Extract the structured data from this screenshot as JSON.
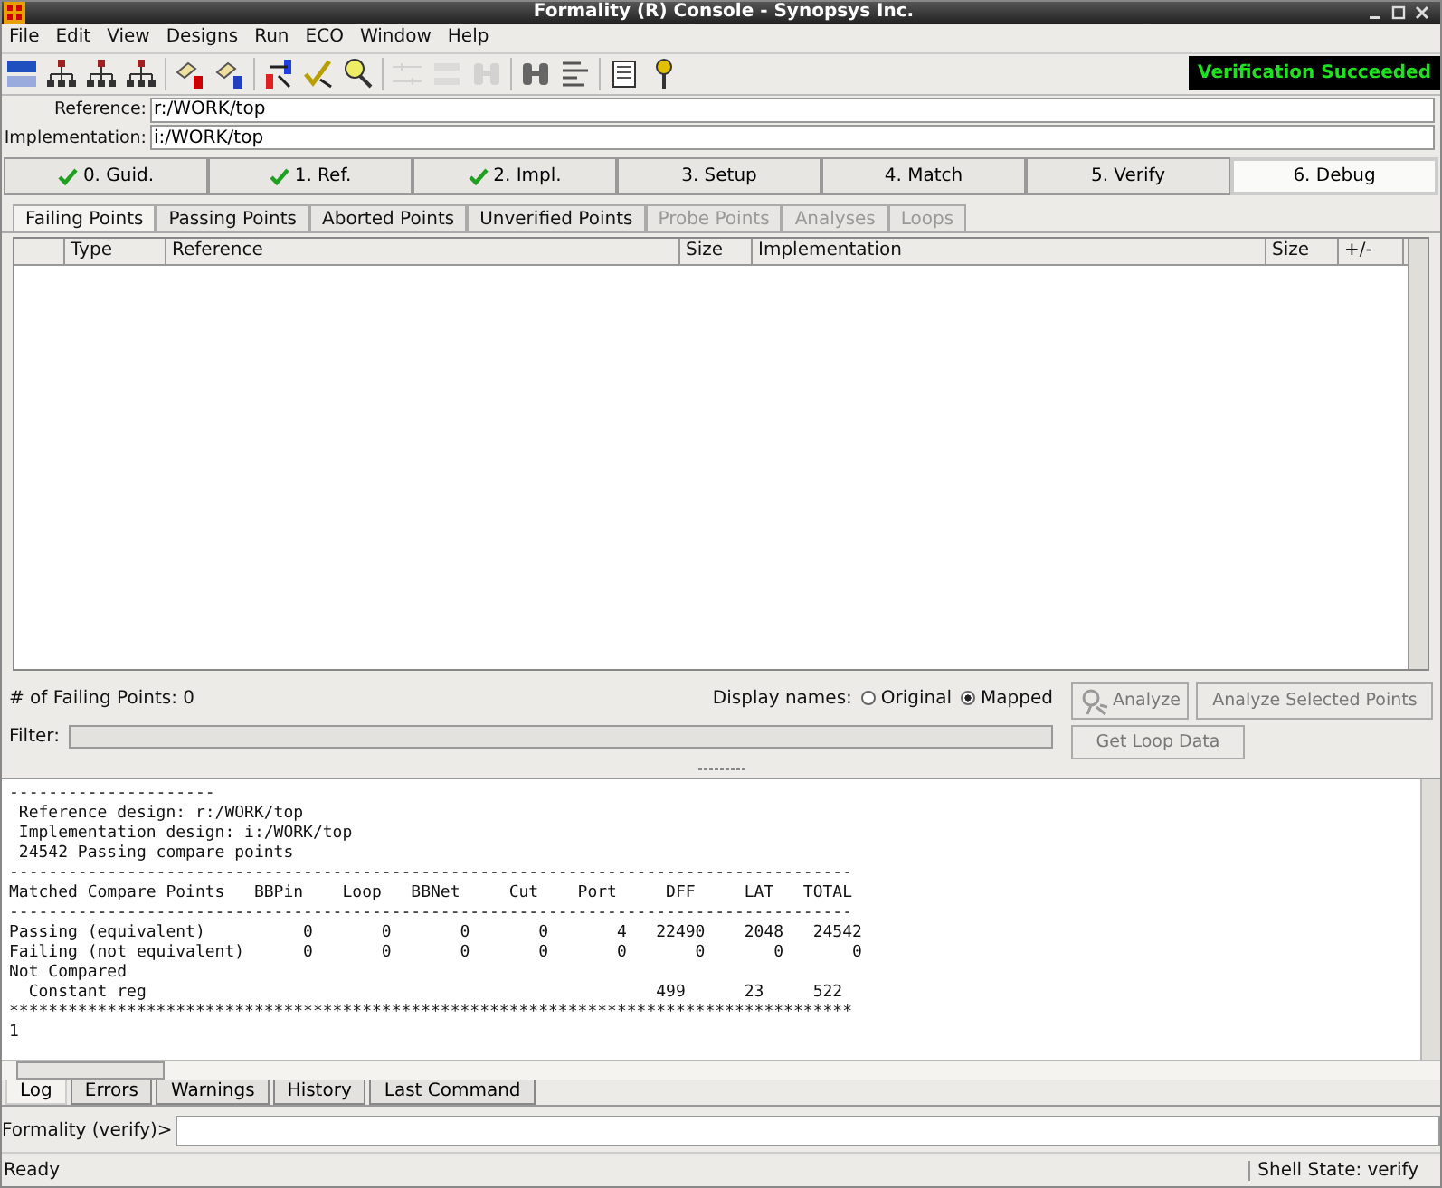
{
  "window": {
    "title": "Formality (R) Console - Synopsys Inc."
  },
  "menu": [
    "File",
    "Edit",
    "View",
    "Designs",
    "Run",
    "ECO",
    "Window",
    "Help"
  ],
  "verification_status": "Verification Succeeded",
  "designs": [
    {
      "label": "Reference:",
      "value": "r:/WORK/top"
    },
    {
      "label": "Implementation:",
      "value": "i:/WORK/top"
    }
  ],
  "steps": [
    {
      "label": "0. Guid.",
      "done": true,
      "selected": false
    },
    {
      "label": "1. Ref.",
      "done": true,
      "selected": false
    },
    {
      "label": "2. Impl.",
      "done": true,
      "selected": false
    },
    {
      "label": "3. Setup",
      "done": false,
      "selected": false
    },
    {
      "label": "4. Match",
      "done": false,
      "selected": false
    },
    {
      "label": "5. Verify",
      "done": false,
      "selected": false
    },
    {
      "label": "6. Debug",
      "done": false,
      "selected": true
    }
  ],
  "tabs": [
    {
      "label": "Failing Points",
      "selected": true,
      "disabled": false
    },
    {
      "label": "Passing Points",
      "selected": false,
      "disabled": false
    },
    {
      "label": "Aborted Points",
      "selected": false,
      "disabled": false
    },
    {
      "label": "Unverified Points",
      "selected": false,
      "disabled": false
    },
    {
      "label": "Probe Points",
      "selected": false,
      "disabled": true
    },
    {
      "label": "Analyses",
      "selected": false,
      "disabled": true
    },
    {
      "label": "Loops",
      "selected": false,
      "disabled": true
    }
  ],
  "table": {
    "columns": [
      "Type",
      "Reference",
      "Size",
      "Implementation",
      "Size",
      "+/-"
    ]
  },
  "count_label": "# of Failing Points: 0",
  "display_names": {
    "label": "Display names:",
    "options": [
      {
        "label": "Original",
        "selected": false
      },
      {
        "label": "Mapped",
        "selected": true
      }
    ]
  },
  "buttons": [
    {
      "label": "Analyze",
      "disabled": true
    },
    {
      "label": "Analyze Selected Points",
      "disabled": true
    },
    {
      "label": "Get Loop Data",
      "disabled": true
    }
  ],
  "filter": {
    "label": "Filter:"
  },
  "log_lines": [
    "---------------------",
    " Reference design: r:/WORK/top",
    " Implementation design: i:/WORK/top",
    " 24542 Passing compare points",
    "--------------------------------------------------------------------------------------",
    "Matched Compare Points   BBPin    Loop   BBNet     Cut    Port     DFF     LAT   TOTAL",
    "--------------------------------------------------------------------------------------",
    "Passing (equivalent)          0       0       0       0       4   22490    2048   24542",
    "Failing (not equivalent)      0       0       0       0       0       0       0       0",
    "Not Compared",
    "  Constant reg                                                    499      23     522",
    "**************************************************************************************",
    "1"
  ],
  "log_tabs": [
    {
      "label": "Log",
      "selected": true
    },
    {
      "label": "Errors",
      "selected": false
    },
    {
      "label": "Warnings",
      "selected": false
    },
    {
      "label": "History",
      "selected": false
    },
    {
      "label": "Last Command",
      "selected": false
    }
  ],
  "prompt": "Formality (verify)>",
  "status_bar": {
    "message": "Ready",
    "shell_state": "Shell State: verify"
  }
}
